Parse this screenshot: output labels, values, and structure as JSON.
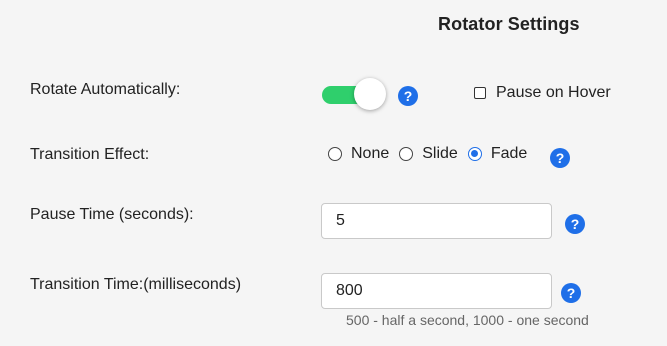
{
  "title": "Rotator Settings",
  "rotate": {
    "label": "Rotate Automatically:",
    "enabled": true,
    "help": "?"
  },
  "pause_on_hover": {
    "label": "Pause on Hover",
    "checked": false
  },
  "transition_effect": {
    "label": "Transition Effect:",
    "options": [
      {
        "label": "None",
        "selected": false
      },
      {
        "label": "Slide",
        "selected": false
      },
      {
        "label": "Fade",
        "selected": true
      }
    ],
    "help": "?"
  },
  "pause_time": {
    "label": "Pause Time (seconds):",
    "value": "5",
    "help": "?"
  },
  "transition_time": {
    "label": "Transition Time:(milliseconds)",
    "value": "800",
    "hint": "500 - half a second, 1000 - one second",
    "help": "?"
  },
  "colors": {
    "toggle_on": "#2fcf6c",
    "help_icon": "#1f6fe8",
    "background": "#f5f5f5"
  },
  "icons": {
    "help": "question-circle-icon"
  }
}
